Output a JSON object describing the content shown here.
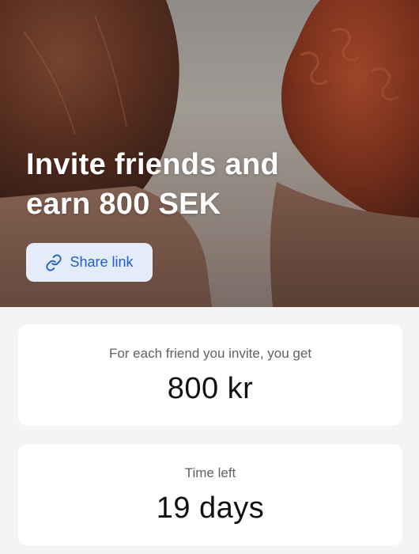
{
  "hero": {
    "title_line1": "Invite friends and",
    "title_line2": "earn 800 SEK",
    "share_button": {
      "label": "Share link",
      "icon": "link-icon",
      "background": "#e4ecf9",
      "text_color": "#1f5ec7"
    }
  },
  "reward_card": {
    "caption": "For each friend you invite, you get",
    "value": "800 kr"
  },
  "time_card": {
    "caption": "Time left",
    "value": "19 days"
  }
}
